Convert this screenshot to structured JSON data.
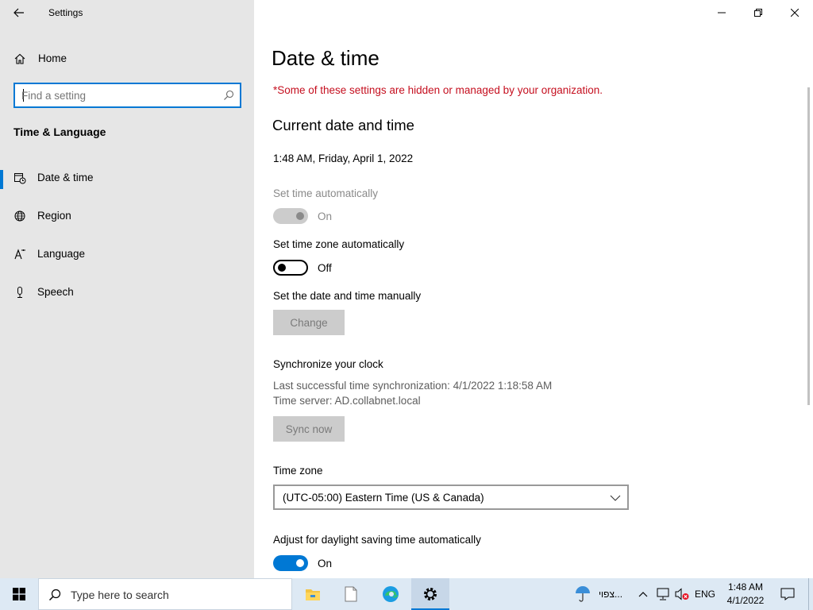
{
  "window": {
    "app_title": "Settings"
  },
  "sidebar": {
    "home_label": "Home",
    "search_placeholder": "Find a setting",
    "section_title": "Time & Language",
    "items": [
      {
        "label": "Date & time",
        "icon": "date-time-icon",
        "selected": true
      },
      {
        "label": "Region",
        "icon": "region-globe-icon",
        "selected": false
      },
      {
        "label": "Language",
        "icon": "language-icon",
        "selected": false
      },
      {
        "label": "Speech",
        "icon": "microphone-icon",
        "selected": false
      }
    ]
  },
  "main": {
    "title": "Date & time",
    "org_note": "*Some of these settings are hidden or managed by your organization.",
    "current_heading": "Current date and time",
    "current_value": "1:48 AM, Friday, April 1, 2022",
    "set_time_auto": {
      "label": "Set time automatically",
      "state": "On",
      "enabled": false
    },
    "set_tz_auto": {
      "label": "Set time zone automatically",
      "state": "Off",
      "enabled": true
    },
    "manual": {
      "label": "Set the date and time manually",
      "button": "Change"
    },
    "sync": {
      "heading": "Synchronize your clock",
      "last_sync": "Last successful time synchronization: 4/1/2022 1:18:58 AM",
      "server": "Time server: AD.collabnet.local",
      "button": "Sync now"
    },
    "timezone": {
      "label": "Time zone",
      "value": "(UTC-05:00) Eastern Time (US & Canada)"
    },
    "dst": {
      "label": "Adjust for daylight saving time automatically",
      "state": "On"
    }
  },
  "taskbar": {
    "search_placeholder": "Type here to search",
    "apps": [
      "file-explorer-icon",
      "notepad-icon",
      "edge-icon",
      "settings-icon"
    ],
    "weather_text": "צפוי...",
    "language": "ENG",
    "time": "1:48 AM",
    "date": "4/1/2022"
  },
  "colors": {
    "accent": "#0078d4",
    "warning": "#c50f1f",
    "sidebar_bg": "#e6e6e6",
    "taskbar_bg": "#dde9f4"
  }
}
